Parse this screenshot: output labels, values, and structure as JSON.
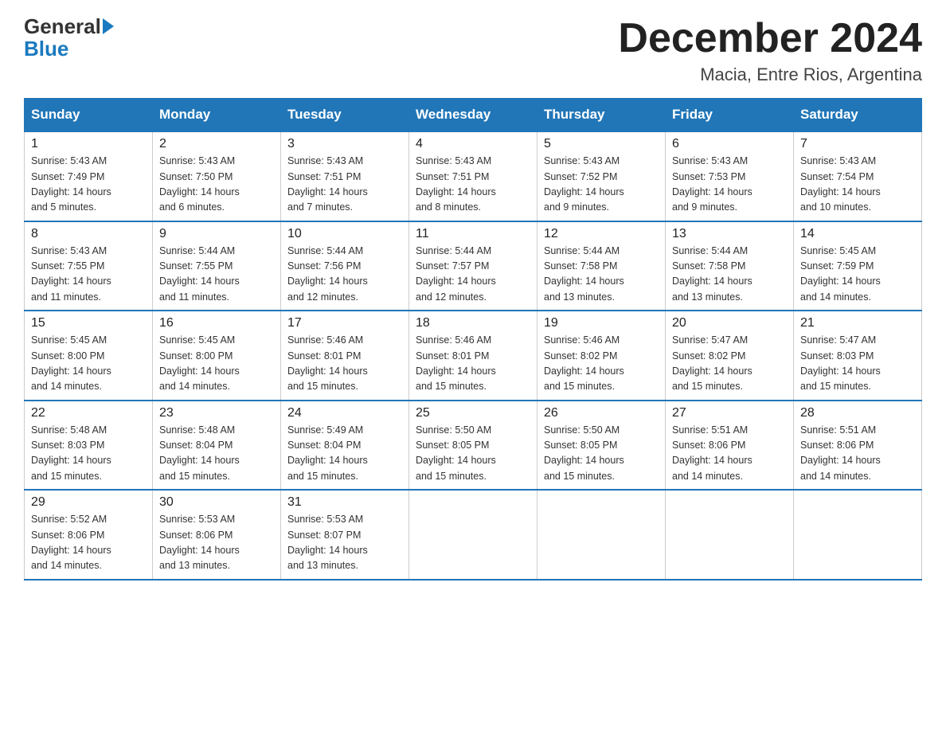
{
  "logo": {
    "general": "General",
    "blue": "Blue"
  },
  "title": "December 2024",
  "location": "Macia, Entre Rios, Argentina",
  "days_of_week": [
    "Sunday",
    "Monday",
    "Tuesday",
    "Wednesday",
    "Thursday",
    "Friday",
    "Saturday"
  ],
  "weeks": [
    [
      {
        "day": "1",
        "sunrise": "5:43 AM",
        "sunset": "7:49 PM",
        "daylight": "14 hours and 5 minutes."
      },
      {
        "day": "2",
        "sunrise": "5:43 AM",
        "sunset": "7:50 PM",
        "daylight": "14 hours and 6 minutes."
      },
      {
        "day": "3",
        "sunrise": "5:43 AM",
        "sunset": "7:51 PM",
        "daylight": "14 hours and 7 minutes."
      },
      {
        "day": "4",
        "sunrise": "5:43 AM",
        "sunset": "7:51 PM",
        "daylight": "14 hours and 8 minutes."
      },
      {
        "day": "5",
        "sunrise": "5:43 AM",
        "sunset": "7:52 PM",
        "daylight": "14 hours and 9 minutes."
      },
      {
        "day": "6",
        "sunrise": "5:43 AM",
        "sunset": "7:53 PM",
        "daylight": "14 hours and 9 minutes."
      },
      {
        "day": "7",
        "sunrise": "5:43 AM",
        "sunset": "7:54 PM",
        "daylight": "14 hours and 10 minutes."
      }
    ],
    [
      {
        "day": "8",
        "sunrise": "5:43 AM",
        "sunset": "7:55 PM",
        "daylight": "14 hours and 11 minutes."
      },
      {
        "day": "9",
        "sunrise": "5:44 AM",
        "sunset": "7:55 PM",
        "daylight": "14 hours and 11 minutes."
      },
      {
        "day": "10",
        "sunrise": "5:44 AM",
        "sunset": "7:56 PM",
        "daylight": "14 hours and 12 minutes."
      },
      {
        "day": "11",
        "sunrise": "5:44 AM",
        "sunset": "7:57 PM",
        "daylight": "14 hours and 12 minutes."
      },
      {
        "day": "12",
        "sunrise": "5:44 AM",
        "sunset": "7:58 PM",
        "daylight": "14 hours and 13 minutes."
      },
      {
        "day": "13",
        "sunrise": "5:44 AM",
        "sunset": "7:58 PM",
        "daylight": "14 hours and 13 minutes."
      },
      {
        "day": "14",
        "sunrise": "5:45 AM",
        "sunset": "7:59 PM",
        "daylight": "14 hours and 14 minutes."
      }
    ],
    [
      {
        "day": "15",
        "sunrise": "5:45 AM",
        "sunset": "8:00 PM",
        "daylight": "14 hours and 14 minutes."
      },
      {
        "day": "16",
        "sunrise": "5:45 AM",
        "sunset": "8:00 PM",
        "daylight": "14 hours and 14 minutes."
      },
      {
        "day": "17",
        "sunrise": "5:46 AM",
        "sunset": "8:01 PM",
        "daylight": "14 hours and 15 minutes."
      },
      {
        "day": "18",
        "sunrise": "5:46 AM",
        "sunset": "8:01 PM",
        "daylight": "14 hours and 15 minutes."
      },
      {
        "day": "19",
        "sunrise": "5:46 AM",
        "sunset": "8:02 PM",
        "daylight": "14 hours and 15 minutes."
      },
      {
        "day": "20",
        "sunrise": "5:47 AM",
        "sunset": "8:02 PM",
        "daylight": "14 hours and 15 minutes."
      },
      {
        "day": "21",
        "sunrise": "5:47 AM",
        "sunset": "8:03 PM",
        "daylight": "14 hours and 15 minutes."
      }
    ],
    [
      {
        "day": "22",
        "sunrise": "5:48 AM",
        "sunset": "8:03 PM",
        "daylight": "14 hours and 15 minutes."
      },
      {
        "day": "23",
        "sunrise": "5:48 AM",
        "sunset": "8:04 PM",
        "daylight": "14 hours and 15 minutes."
      },
      {
        "day": "24",
        "sunrise": "5:49 AM",
        "sunset": "8:04 PM",
        "daylight": "14 hours and 15 minutes."
      },
      {
        "day": "25",
        "sunrise": "5:50 AM",
        "sunset": "8:05 PM",
        "daylight": "14 hours and 15 minutes."
      },
      {
        "day": "26",
        "sunrise": "5:50 AM",
        "sunset": "8:05 PM",
        "daylight": "14 hours and 15 minutes."
      },
      {
        "day": "27",
        "sunrise": "5:51 AM",
        "sunset": "8:06 PM",
        "daylight": "14 hours and 14 minutes."
      },
      {
        "day": "28",
        "sunrise": "5:51 AM",
        "sunset": "8:06 PM",
        "daylight": "14 hours and 14 minutes."
      }
    ],
    [
      {
        "day": "29",
        "sunrise": "5:52 AM",
        "sunset": "8:06 PM",
        "daylight": "14 hours and 14 minutes."
      },
      {
        "day": "30",
        "sunrise": "5:53 AM",
        "sunset": "8:06 PM",
        "daylight": "14 hours and 13 minutes."
      },
      {
        "day": "31",
        "sunrise": "5:53 AM",
        "sunset": "8:07 PM",
        "daylight": "14 hours and 13 minutes."
      },
      null,
      null,
      null,
      null
    ]
  ],
  "labels": {
    "sunrise": "Sunrise:",
    "sunset": "Sunset:",
    "daylight": "Daylight:"
  }
}
